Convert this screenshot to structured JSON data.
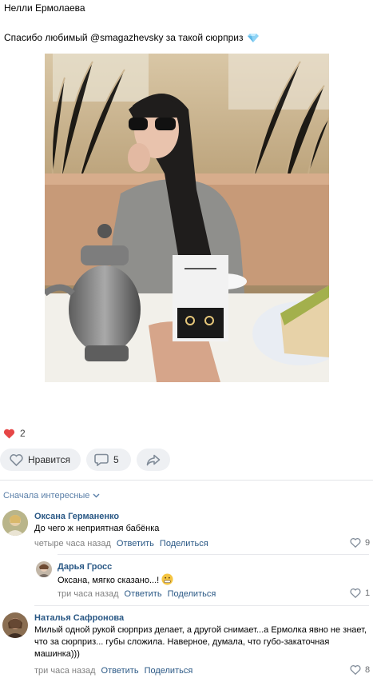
{
  "post": {
    "author": "Нелли Ермолаева",
    "text": "Спасибо любимый @smagazhevsky за такой сюрприз",
    "text_emoji": "gem-icon",
    "photo_alt": "photo"
  },
  "reactions": {
    "icon": "heart-icon",
    "count": "2"
  },
  "actions": {
    "like_label": "Нравится",
    "comments_count": "5",
    "share_icon": "share-arrow-icon"
  },
  "comments_sort": {
    "label": "Сначала интересные"
  },
  "comments": [
    {
      "name": "Оксана Германенко",
      "text": "До чего ж неприятная бабёнка",
      "time": "четыре часа назад",
      "reply": "Ответить",
      "share": "Поделиться",
      "likes": "9"
    },
    {
      "name": "Дарья Гросс",
      "text": "Оксана, мягко сказано...!",
      "time": "три часа назад",
      "reply": "Ответить",
      "share": "Поделиться",
      "likes": "1"
    },
    {
      "name": "Наталья Сафронова",
      "text": "Милый одной рукой сюрприз делает, а другой снимает...а Ермолка явно не знает, что за сюрприз... губы сложила. Наверное, думала, что губо-закаточная машинка)))",
      "time": "три часа назад",
      "reply": "Ответить",
      "share": "Поделиться",
      "likes": "8"
    }
  ],
  "colors": {
    "link": "#2a5885",
    "accent_red": "#e64646",
    "pill_bg": "#eef0f3"
  }
}
